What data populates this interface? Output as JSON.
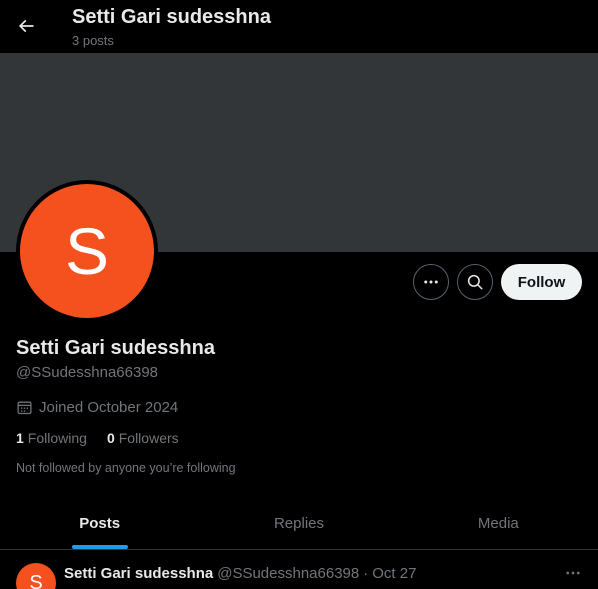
{
  "header": {
    "title": "Setti Gari sudesshna",
    "subtitle": "3 posts"
  },
  "profile": {
    "avatar_letter": "S",
    "display_name": "Setti Gari sudesshna",
    "handle": "@SSudesshna66398",
    "joined": "Joined October 2024",
    "following_count": "1",
    "following_label": "Following",
    "followers_count": "0",
    "followers_label": "Followers",
    "not_followed_text": "Not followed by anyone you’re following"
  },
  "actions": {
    "follow_label": "Follow",
    "more_icon": "more-horizontal-icon",
    "search_icon": "search-icon"
  },
  "tabs": [
    {
      "label": "Posts",
      "active": true
    },
    {
      "label": "Replies",
      "active": false
    },
    {
      "label": "Media",
      "active": false
    }
  ],
  "post": {
    "avatar_letter": "S",
    "name": "Setti Gari sudesshna",
    "handle": "@SSudesshna66398",
    "separator": "·",
    "date": "Oct 27"
  },
  "colors": {
    "background": "#000000",
    "banner": "#333639",
    "avatar": "#f4511e",
    "accent": "#1d9bf0",
    "text_primary": "#e7e9ea",
    "text_secondary": "#71767b",
    "follow_button": "#eff3f4"
  }
}
